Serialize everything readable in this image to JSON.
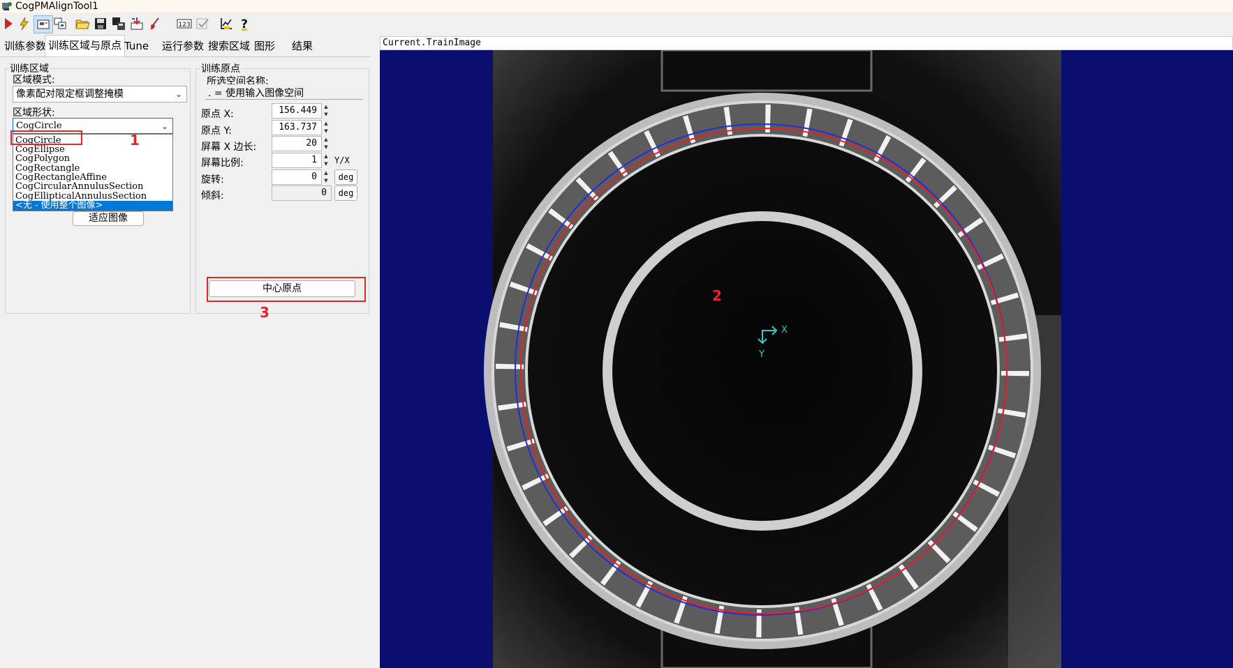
{
  "window": {
    "title": "CogPMAlignTool1"
  },
  "toolbar": {
    "buttons": [
      {
        "name": "run",
        "icon": "play-icon",
        "color": "#c62828"
      },
      {
        "name": "electric",
        "icon": "lightning-icon",
        "color": "#d4b000"
      },
      {
        "name": "image-view",
        "icon": "image-view-icon"
      },
      {
        "name": "copy-windows",
        "icon": "windows-icon"
      },
      {
        "name": "open",
        "icon": "open-folder-icon"
      },
      {
        "name": "save",
        "icon": "save-icon"
      },
      {
        "name": "save-as",
        "icon": "save-as-icon"
      },
      {
        "name": "import",
        "icon": "import-icon"
      },
      {
        "name": "reset",
        "icon": "brush-icon"
      },
      {
        "name": "number-display",
        "icon": "number-icon",
        "label": "123"
      },
      {
        "name": "check",
        "icon": "check-icon"
      },
      {
        "name": "graphics",
        "icon": "graph-icon"
      },
      {
        "name": "help",
        "icon": "help-icon",
        "label": "?"
      }
    ]
  },
  "tabs": [
    "训练参数",
    "训练区域与原点",
    "Tune",
    "运行参数",
    "搜索区域",
    "图形",
    "结果"
  ],
  "active_tab": "训练区域与原点",
  "train_region": {
    "legend": "训练区域",
    "mode_label": "区域模式:",
    "mode_value": "像素配对限定框调整掩模",
    "shape_label": "区域形状:",
    "shape_value": "CogCircle",
    "shape_options": [
      "CogCircle",
      "CogEllipse",
      "CogPolygon",
      "CogRectangle",
      "CogRectangleAffine",
      "CogCircularAnnulusSection",
      "CogEllipticalAnnulusSection",
      "<无 - 使用整个图像>"
    ],
    "highlighted_option": "<无 - 使用整个图像>",
    "fit_button": "适应图像"
  },
  "train_origin": {
    "legend": "训练原点",
    "space_label": "所选空间名称:",
    "space_value": ". = 使用输入图像空间",
    "origin_x_label": "原点 X:",
    "origin_x": "156.449",
    "origin_y_label": "原点 Y:",
    "origin_y": "163.737",
    "screen_x_label": "屏幕 X 边长:",
    "screen_x": "20",
    "screen_ratio_label": "屏幕比例:",
    "screen_ratio": "1",
    "ratio_unit": "Y/X",
    "rotation_label": "旋转:",
    "rotation": "0",
    "skew_label": "倾斜:",
    "skew": "0",
    "deg": "deg",
    "center_button": "中心原点"
  },
  "annotations": {
    "n1": "1",
    "n2": "2",
    "n3": "3",
    "color": "#e2262a"
  },
  "image_view": {
    "header": "Current.TrainImage",
    "axis_x": "X",
    "axis_y": "Y",
    "background": "#0b0e6e"
  }
}
